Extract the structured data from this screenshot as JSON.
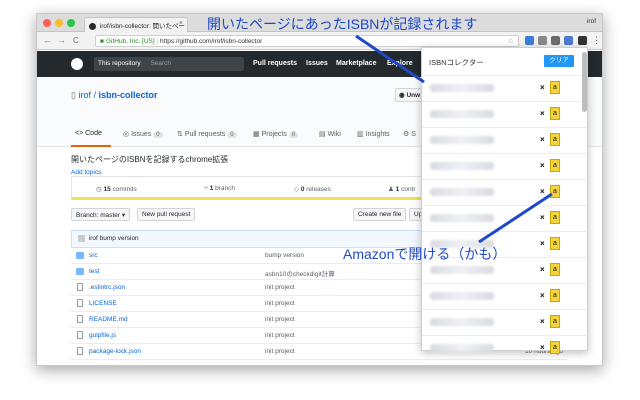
{
  "browser": {
    "tab_title": "irof/isbn-collector: 開いたペー",
    "tab_close": "×",
    "profile": "irof",
    "address_secure_label": "GitHub, Inc. [US]",
    "address_url": "https://github.com/irof/isbn-collector",
    "nav_back": "←",
    "nav_forward": "→",
    "nav_reload": "C",
    "star": "☆"
  },
  "github_header": {
    "scope_label": "This repository",
    "search_placeholder": "Search",
    "nav": [
      "Pull requests",
      "Issues",
      "Marketplace",
      "Explore"
    ]
  },
  "repo": {
    "owner": "irof",
    "separator": " / ",
    "name": "isbn-collector",
    "watch_label": "Unw",
    "tabs": [
      {
        "label": "Code",
        "count": ""
      },
      {
        "label": "Issues",
        "count": "0"
      },
      {
        "label": "Pull requests",
        "count": "0"
      },
      {
        "label": "Projects",
        "count": "0"
      },
      {
        "label": "Wiki",
        "count": ""
      },
      {
        "label": "Insights",
        "count": ""
      },
      {
        "label": "S",
        "count": ""
      }
    ],
    "description": "開いたページのISBNを記録するchrome拡張",
    "add_topics": "Add topics",
    "stats": [
      {
        "num": "15",
        "label": "commits"
      },
      {
        "num": "1",
        "label": "branch"
      },
      {
        "num": "0",
        "label": "releases"
      },
      {
        "num": "1",
        "label": "contr"
      }
    ],
    "branch_label": "Branch: master ▾",
    "new_pr_label": "New pull request",
    "create_file_label": "Create new file",
    "upload_label": "Up",
    "latest_commit_author": "irof",
    "latest_commit_msg": "bump version",
    "files": [
      {
        "type": "folder",
        "name": "src",
        "msg": "bump version",
        "age": ""
      },
      {
        "type": "folder",
        "name": "test",
        "msg": "asbn10のcheckdigit計算",
        "age": ""
      },
      {
        "type": "file",
        "name": ".eslintrc.json",
        "msg": "init project",
        "age": ""
      },
      {
        "type": "file",
        "name": "LICENSE",
        "msg": "init project",
        "age": ""
      },
      {
        "type": "file",
        "name": "README.md",
        "msg": "init project",
        "age": ""
      },
      {
        "type": "file",
        "name": "gulpfile.js",
        "msg": "init project",
        "age": ""
      },
      {
        "type": "file",
        "name": "package-lock.json",
        "msg": "init project",
        "age": "10 hours ago"
      }
    ]
  },
  "popup": {
    "title": "ISBNコレクター",
    "clear_label": "クリア",
    "delete_label": "×",
    "amazon_label": "a",
    "rows": 11
  },
  "annotations": {
    "top": "開いたページにあったISBNが記録されます",
    "amazon": "Amazonで開ける（かも）"
  },
  "colors": {
    "callout": "#1f49c8",
    "clear_button": "#2196f3",
    "amazon_button": "#f5d33a",
    "github_header": "#24292e",
    "language_bar": "#f1e05a"
  }
}
